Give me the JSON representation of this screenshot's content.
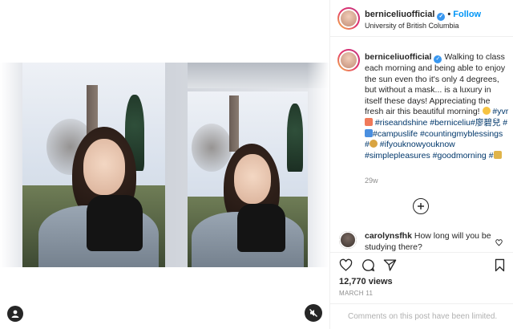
{
  "post": {
    "username": "berniceliuofficial",
    "separator": "•",
    "follow_label": "Follow",
    "location": "University of British Columbia"
  },
  "caption": {
    "username": "berniceliuofficial",
    "text_1": "Walking to class each morning and being able to enjoy the sun even tho it's only 4 degrees, but without a mask... is a luxury in itself these days! Appreciating the fresh air this beautiful morning!",
    "tag_yvr": "#yvr",
    "tag_riseandshine": "#riseandshine",
    "tag_berniceliu": "#berniceliu",
    "tag_chinese": "#廖碧兒",
    "tag_hash": "#",
    "tag_campuslife": "#campuslife",
    "tag_blessings": "#countingmyblessings",
    "tag_hash2": "#",
    "tag_ifyouknow": "#ifyouknowyouknow",
    "tag_simple": "#simplepleasures",
    "tag_goodmorning": "#goodmorning",
    "tag_hash3": "#",
    "age": "29w"
  },
  "comment": {
    "username": "carolynsfhk",
    "text": "How long will you be studying there?"
  },
  "stats": {
    "views": "12,770 views",
    "date": "MARCH 11"
  },
  "footer": {
    "limited_text": "Comments on this post have been limited."
  },
  "icons": {
    "verified": "verified-badge-icon",
    "user_tag": "user-tag-icon",
    "mute": "muted-speaker-icon",
    "load_more": "plus-circle-icon",
    "like": "heart-icon",
    "comment": "comment-bubble-icon",
    "share": "paper-plane-icon",
    "save": "bookmark-icon"
  },
  "colors": {
    "link_blue": "#0095f6",
    "hashtag": "#00376b",
    "verified": "#3897f0",
    "muted_text": "#8e8e8e"
  }
}
